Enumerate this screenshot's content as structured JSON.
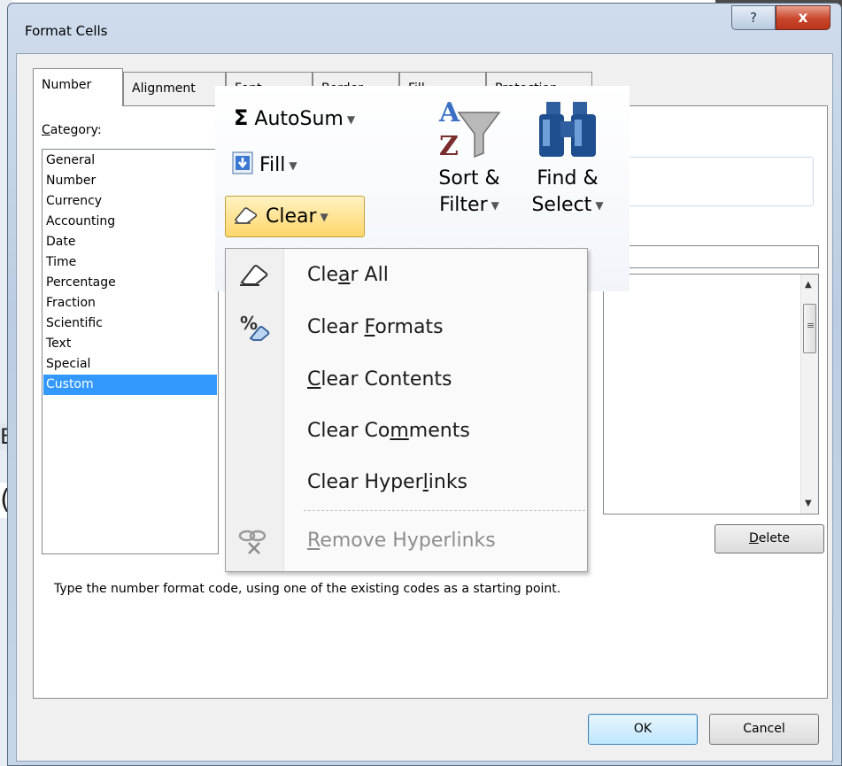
{
  "window": {
    "title": "Format Cells",
    "help_label": "?",
    "close_label": "x"
  },
  "tabs": [
    {
      "label": "Number",
      "active": true
    },
    {
      "label": "Alignment",
      "active": false
    },
    {
      "label": "Font",
      "active": false
    },
    {
      "label": "Border",
      "active": false
    },
    {
      "label": "Fill",
      "active": false
    },
    {
      "label": "Protection",
      "active": false
    }
  ],
  "category": {
    "label_prefix": "",
    "label_ul": "C",
    "label_rest": "ategory:",
    "items": [
      "General",
      "Number",
      "Currency",
      "Accounting",
      "Date",
      "Time",
      "Percentage",
      "Fraction",
      "Scientific",
      "Text",
      "Special",
      "Custom"
    ],
    "selected": "Custom"
  },
  "buttons": {
    "delete_ul": "D",
    "delete_rest": "elete",
    "ok": "OK",
    "cancel": "Cancel"
  },
  "hint": "Type the number format code, using one of the existing codes as a starting point.",
  "ribbon": {
    "autosum_label": "AutoSum",
    "fill_label": "Fill",
    "clear_label": "Clear",
    "sort_line1": "Sort &",
    "sort_line2": "Filter",
    "find_line1": "Find &",
    "find_line2": "Select"
  },
  "clear_menu": {
    "items": [
      {
        "pre": "Cle",
        "ul": "a",
        "post": "r All",
        "icon": "eraser-icon",
        "disabled": false
      },
      {
        "pre": "Clear ",
        "ul": "F",
        "post": "ormats",
        "icon": "clear-formats-icon",
        "disabled": false
      },
      {
        "pre": "",
        "ul": "C",
        "post": "lear Contents",
        "icon": "",
        "disabled": false
      },
      {
        "pre": "Clear Co",
        "ul": "m",
        "post": "ments",
        "icon": "",
        "disabled": false
      },
      {
        "pre": "Clear Hyper",
        "ul": "l",
        "post": "inks",
        "icon": "",
        "disabled": false
      },
      {
        "pre": "",
        "ul": "R",
        "post": "emove Hyperlinks",
        "icon": "remove-hyperlink-icon",
        "disabled": true
      }
    ]
  },
  "background_cells": {
    "b_fragment": "B",
    "paren_fragment": "(/"
  },
  "colors": {
    "selection": "#3399ff",
    "close_red": "#c9462b",
    "highlight_gold": "#ffd66b"
  }
}
